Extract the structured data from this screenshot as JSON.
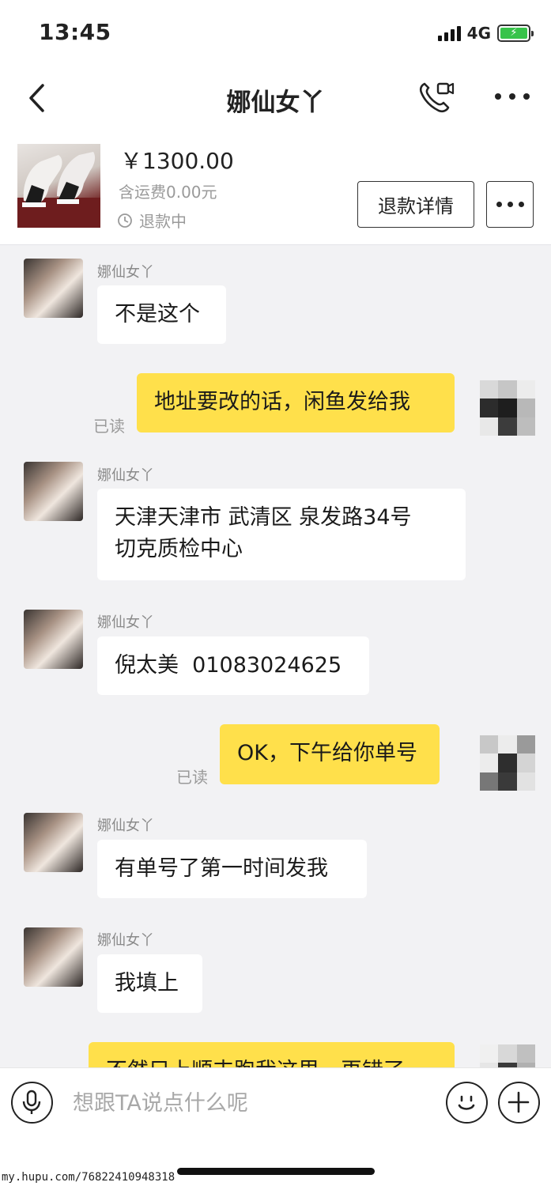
{
  "status_bar": {
    "time": "13:45",
    "network": "4G"
  },
  "nav": {
    "title": "娜仙女丫"
  },
  "product": {
    "price": "￥1300.00",
    "shipping": "含运费0.00元",
    "status": "退款中",
    "refund_button": "退款详情"
  },
  "messages": [
    {
      "side": "them",
      "name": "娜仙女丫",
      "text": "不是这个"
    },
    {
      "side": "me",
      "text": "地址要改的话，闲鱼发给我",
      "read": "已读"
    },
    {
      "side": "them",
      "name": "娜仙女丫",
      "text": "天津天津市 武清区 泉发路34号\n切克质检中心"
    },
    {
      "side": "them",
      "name": "娜仙女丫",
      "text": "倪太美  01083024625"
    },
    {
      "side": "me",
      "text": "OK，下午给你单号",
      "read": "已读"
    },
    {
      "side": "them",
      "name": "娜仙女丫",
      "text": "有单号了第一时间发我"
    },
    {
      "side": "them",
      "name": "娜仙女丫",
      "text": "我填上"
    },
    {
      "side": "me",
      "text": "不然只上顺丰跑我这里，再错了"
    }
  ],
  "input": {
    "placeholder": "想跟TA说点什么呢"
  },
  "watermark": "my.hupu.com/76822410948318",
  "colors": {
    "my_bubble": "#ffe04b",
    "their_bubble": "#ffffff",
    "chat_bg": "#f2f2f4",
    "battery": "#37c34a"
  }
}
